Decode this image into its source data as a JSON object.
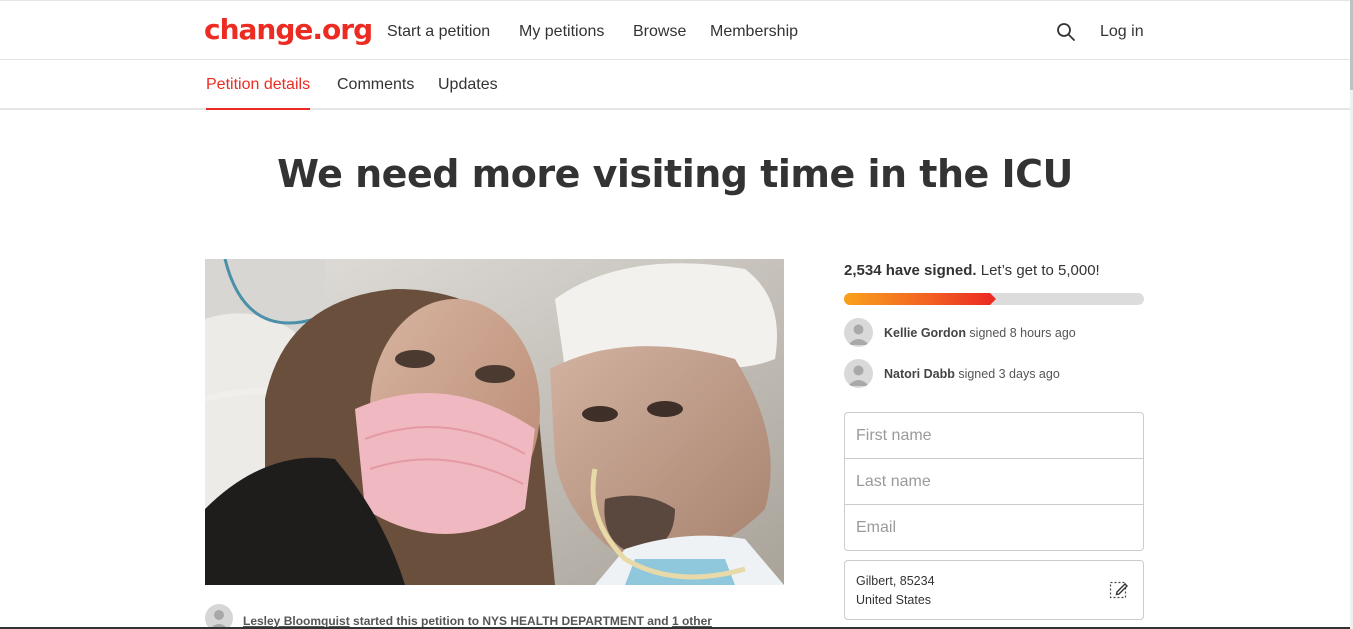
{
  "nav": {
    "logo": "change.org",
    "links": [
      "Start a petition",
      "My petitions",
      "Browse",
      "Membership"
    ],
    "login": "Log in",
    "search_icon": "search-icon"
  },
  "tabs": [
    {
      "label": "Petition details",
      "active": true
    },
    {
      "label": "Comments",
      "active": false
    },
    {
      "label": "Updates",
      "active": false
    }
  ],
  "petition": {
    "title": "We need more visiting time in the ICU",
    "starter_name": "Lesley Bloomquist",
    "starter_mid": " started this petition to ",
    "target": "NYS HEALTH DEPARTMENT",
    "and_text": " and ",
    "other": "1 other"
  },
  "signatures": {
    "count_text": "2,534 have signed.",
    "goal_text": " Let’s get to 5,000!",
    "signed": 2534,
    "goal": 5000,
    "progress_fraction": 0.5068,
    "accent_colors": [
      "#f9a11b",
      "#ec2c22"
    ]
  },
  "recent_signers": [
    {
      "name": "Kellie Gordon",
      "action": " signed 8 hours ago"
    },
    {
      "name": "Natori Dabb",
      "action": " signed 3 days ago"
    }
  ],
  "form": {
    "first_name_placeholder": "First name",
    "last_name_placeholder": "Last name",
    "email_placeholder": "Email",
    "location_line1": "Gilbert, 85234",
    "location_line2": "United States",
    "edit_icon": "edit-icon"
  },
  "brand_color": "#ec2c22"
}
